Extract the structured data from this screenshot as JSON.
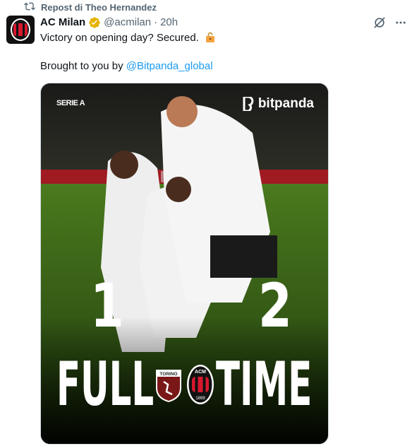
{
  "repost": {
    "label": "Repost di Theo Hernandez",
    "icon": "repost-icon"
  },
  "author": {
    "name": "AC Milan",
    "handle": "@acmilan",
    "separator": "·",
    "time": "20h",
    "verified_color": "#e6b400"
  },
  "tweet": {
    "line1": "Victory on opening day? Secured.",
    "line2_prefix": "Brought to you by ",
    "mention": "@Bitpanda_global"
  },
  "media": {
    "competition": "SERIE A",
    "sponsor": "bitpanda",
    "home_score": "1",
    "away_score": "2",
    "word_left": "FULL",
    "word_right": "TIME",
    "home_team_badge": "TORINO",
    "away_team_badge": "ACM 1899"
  },
  "colors": {
    "link": "#1d9bf0",
    "secondary": "#536471",
    "milan_red": "#d8182e"
  }
}
